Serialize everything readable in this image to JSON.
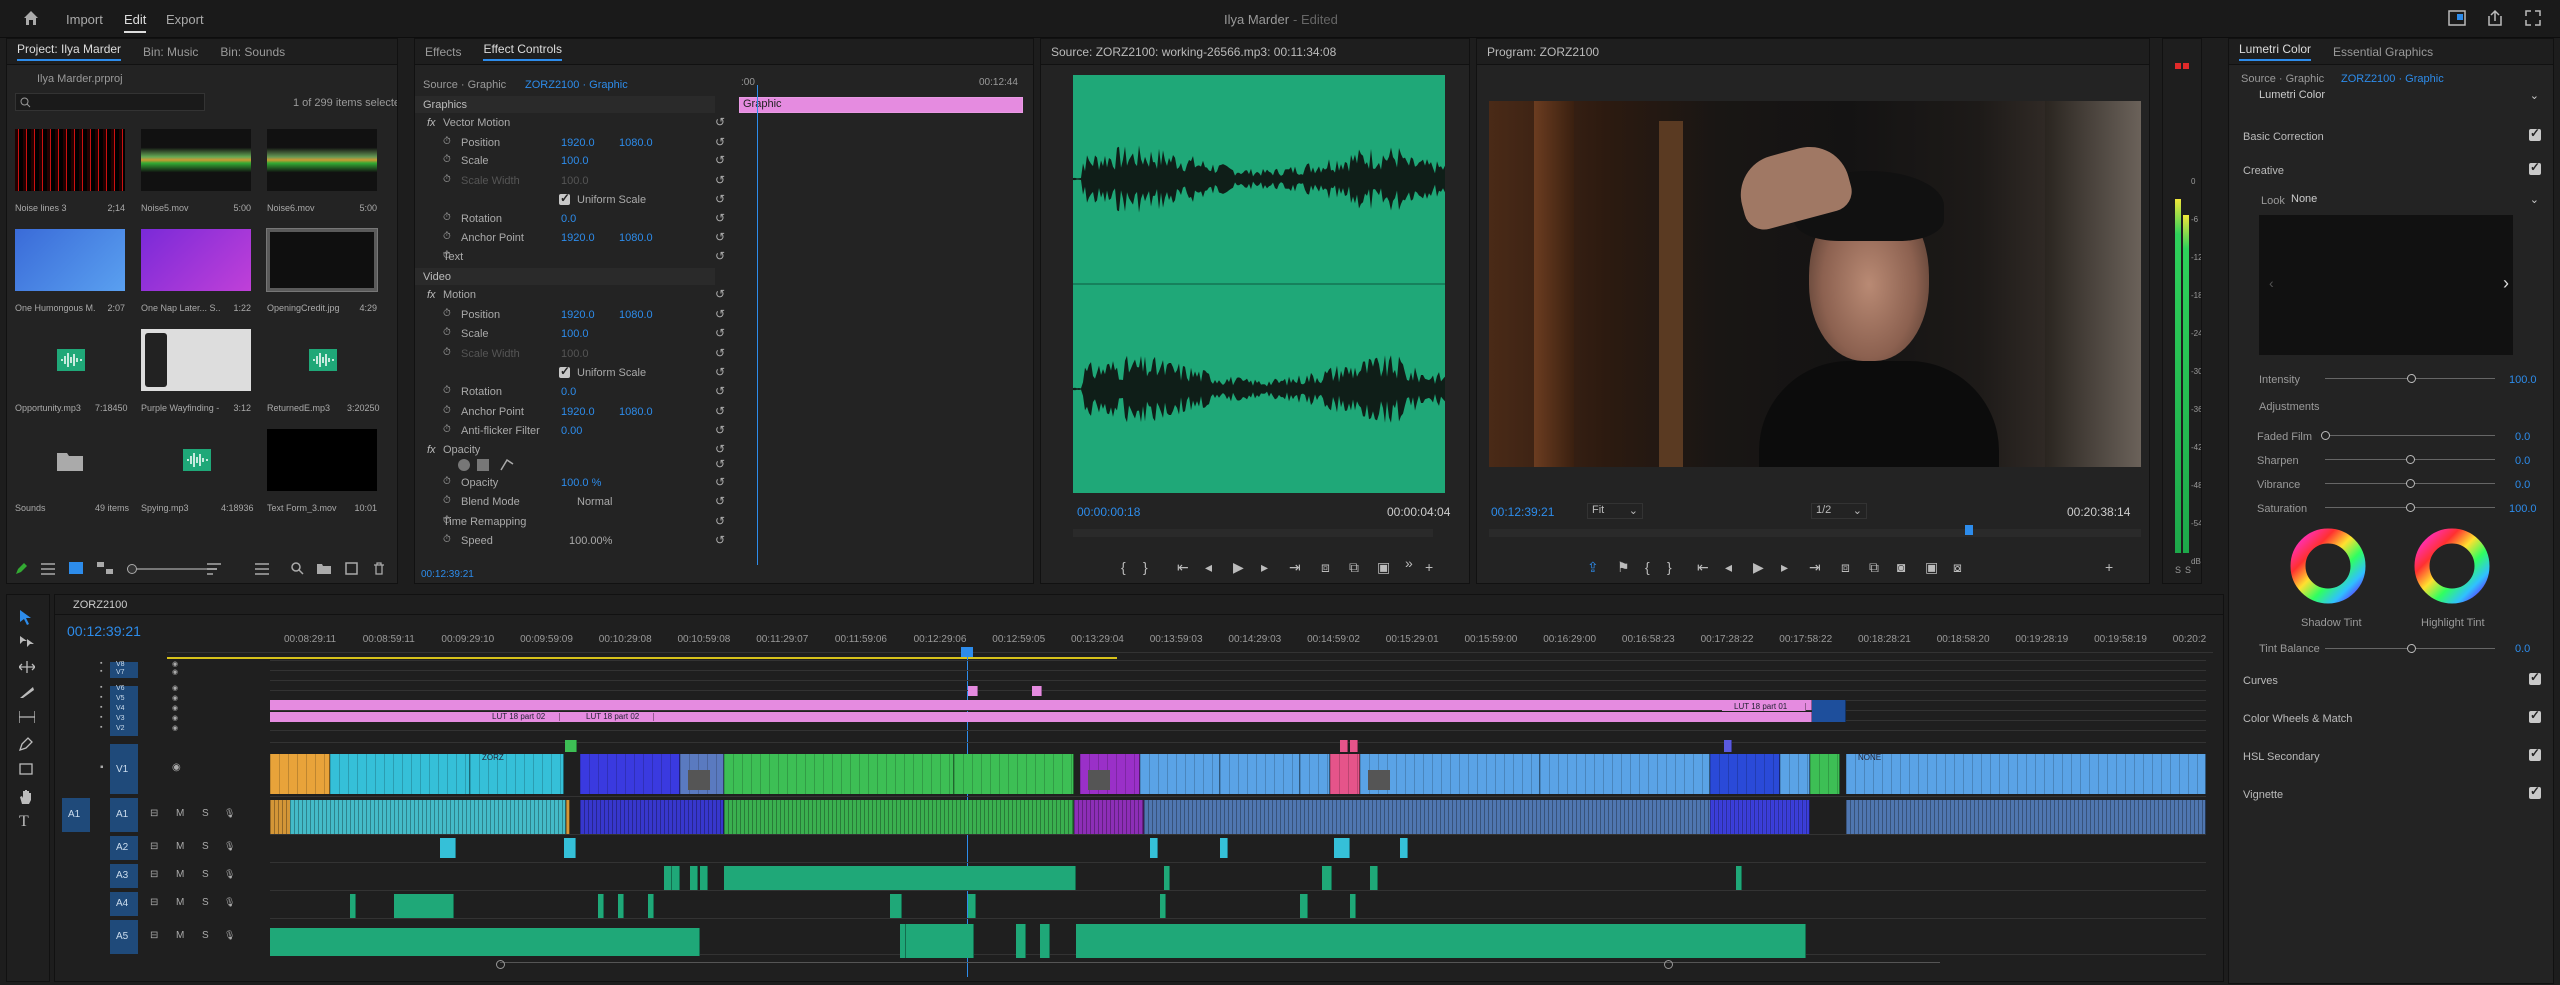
{
  "app": {
    "title": "Ilya Marder",
    "status": "Edited",
    "nav": [
      "Import",
      "Edit",
      "Export"
    ]
  },
  "project": {
    "tabs": [
      "Project: Ilya Marder",
      "Bin: Music",
      "Bin: Sounds"
    ],
    "file": "Ilya Marder.prproj",
    "count": "1 of 299 items selected",
    "items": [
      {
        "name": "Noise lines 3",
        "dur": "2;14"
      },
      {
        "name": "Noise5.mov",
        "dur": "5:00"
      },
      {
        "name": "Noise6.mov",
        "dur": "5:00"
      },
      {
        "name": "One Humongous M...",
        "dur": "2:07"
      },
      {
        "name": "One Nap Later... S...",
        "dur": "1:22"
      },
      {
        "name": "OpeningCredit.jpg",
        "dur": "4:29"
      },
      {
        "name": "Opportunity.mp3",
        "dur": "7:18450"
      },
      {
        "name": "Purple Wayfinding - ...",
        "dur": "3:12"
      },
      {
        "name": "ReturnedE.mp3",
        "dur": "3:20250"
      },
      {
        "name": "Sounds",
        "dur": "49 items"
      },
      {
        "name": "Spying.mp3",
        "dur": "4:18936"
      },
      {
        "name": "Text Form_3.mov",
        "dur": "10:01"
      }
    ]
  },
  "effects": {
    "tabs": [
      "Effects",
      "Effect Controls"
    ],
    "source": "Source · Graphic",
    "clip": "ZORZ2100 · Graphic",
    "time_start": ":00",
    "time_end": "00:12:44",
    "clip_label": "Graphic",
    "timecode": "00:12:39:21",
    "rows": [
      {
        "label": "Graphics",
        "v1": "",
        "v2": ""
      },
      {
        "label": "Vector Motion",
        "v1": "",
        "v2": ""
      },
      {
        "label": "Position",
        "v1": "1920.0",
        "v2": "1080.0"
      },
      {
        "label": "Scale",
        "v1": "100.0",
        "v2": ""
      },
      {
        "label": "Scale Width",
        "v1": "100.0",
        "v2": ""
      },
      {
        "label": "Uniform Scale",
        "v1": "",
        "v2": ""
      },
      {
        "label": "Rotation",
        "v1": "0.0",
        "v2": ""
      },
      {
        "label": "Anchor Point",
        "v1": "1920.0",
        "v2": "1080.0"
      },
      {
        "label": "Text",
        "v1": "",
        "v2": ""
      },
      {
        "label": "Video",
        "v1": "",
        "v2": ""
      },
      {
        "label": "Motion",
        "v1": "",
        "v2": ""
      },
      {
        "label": "Position",
        "v1": "1920.0",
        "v2": "1080.0"
      },
      {
        "label": "Scale",
        "v1": "100.0",
        "v2": ""
      },
      {
        "label": "Scale Width",
        "v1": "100.0",
        "v2": ""
      },
      {
        "label": "Uniform Scale",
        "v1": "",
        "v2": ""
      },
      {
        "label": "Rotation",
        "v1": "0.0",
        "v2": ""
      },
      {
        "label": "Anchor Point",
        "v1": "1920.0",
        "v2": "1080.0"
      },
      {
        "label": "Anti-flicker Filter",
        "v1": "0.00",
        "v2": ""
      },
      {
        "label": "Opacity",
        "v1": "",
        "v2": ""
      },
      {
        "label": "",
        "v1": "",
        "v2": ""
      },
      {
        "label": "Opacity",
        "v1": "100.0 %",
        "v2": ""
      },
      {
        "label": "Blend Mode",
        "v1": "Normal",
        "v2": ""
      },
      {
        "label": "Time Remapping",
        "v1": "",
        "v2": ""
      },
      {
        "label": "Speed",
        "v1": "100.00%",
        "v2": ""
      }
    ]
  },
  "source": {
    "title": "Source: ZORZ2100: working-26566.mp3: 00:11:34:08",
    "time": "00:00:00:18",
    "duration": "00:00:04:04"
  },
  "program": {
    "title": "Program: ZORZ2100",
    "time": "00:12:39:21",
    "fit": "Fit",
    "res": "1/2",
    "duration": "00:20:38:14"
  },
  "meter": {
    "labels": [
      "0",
      "-6",
      "-12",
      "-18",
      "-24",
      "-30",
      "-36",
      "-42",
      "-48",
      "-54",
      "dB"
    ],
    "footer": [
      "S",
      "S"
    ]
  },
  "lumetri": {
    "tabs": [
      "Lumetri Color",
      "Essential Graphics"
    ],
    "source": "Source · Graphic",
    "clip": "ZORZ2100 · Graphic",
    "effect": "Lumetri Color",
    "basic": "Basic Correction",
    "creative": "Creative",
    "look_label": "Look",
    "look": "None",
    "intensity_label": "Intensity",
    "intensity": "100.0",
    "adjustments": "Adjustments",
    "sliders": [
      {
        "label": "Faded Film",
        "value": "0.0"
      },
      {
        "label": "Sharpen",
        "value": "0.0"
      },
      {
        "label": "Vibrance",
        "value": "0.0"
      },
      {
        "label": "Saturation",
        "value": "100.0"
      }
    ],
    "shadow": "Shadow Tint",
    "highlight": "Highlight Tint",
    "tint_balance": "Tint Balance",
    "tint_value": "0.0",
    "sections": [
      "Curves",
      "Color Wheels & Match",
      "HSL Secondary",
      "Vignette"
    ]
  },
  "timeline": {
    "name": "ZORZ2100",
    "timecode": "00:12:39:21",
    "ticks": [
      "00:08:29:11",
      "00:08:59:11",
      "00:09:29:10",
      "00:09:59:09",
      "00:10:29:08",
      "00:10:59:08",
      "00:11:29:07",
      "00:11:59:06",
      "00:12:29:06",
      "00:12:59:05",
      "00:13:29:04",
      "00:13:59:03",
      "00:14:29:03",
      "00:14:59:02",
      "00:15:29:01",
      "00:15:59:00",
      "00:16:29:00",
      "00:16:58:23",
      "00:17:28:22",
      "00:17:58:22",
      "00:18:28:21",
      "00:18:58:20",
      "00:19:28:19",
      "00:19:58:19",
      "00:20:2"
    ],
    "vtracks": [
      "V8",
      "V7",
      "V6",
      "V5",
      "V4",
      "V3",
      "V2",
      "V1"
    ],
    "atracks": [
      "A1",
      "A2",
      "A3",
      "A4",
      "A5"
    ],
    "clip_labels": [
      "LUT 18 part 02",
      "LUT 18 part 02",
      "LUT 18 part 01",
      "ZORZ",
      "NONE"
    ],
    "mute": "M",
    "solo": "S"
  },
  "colors": {
    "accent": "#2d8ceb",
    "graphic": "#e58be0",
    "video_blue": "#5aa3e6",
    "video_cyan": "#35c0d8",
    "video_green": "#3dbf55",
    "video_orange": "#e8a33a",
    "audio_green": "#1fa878",
    "audio_blue": "#5580c0"
  }
}
